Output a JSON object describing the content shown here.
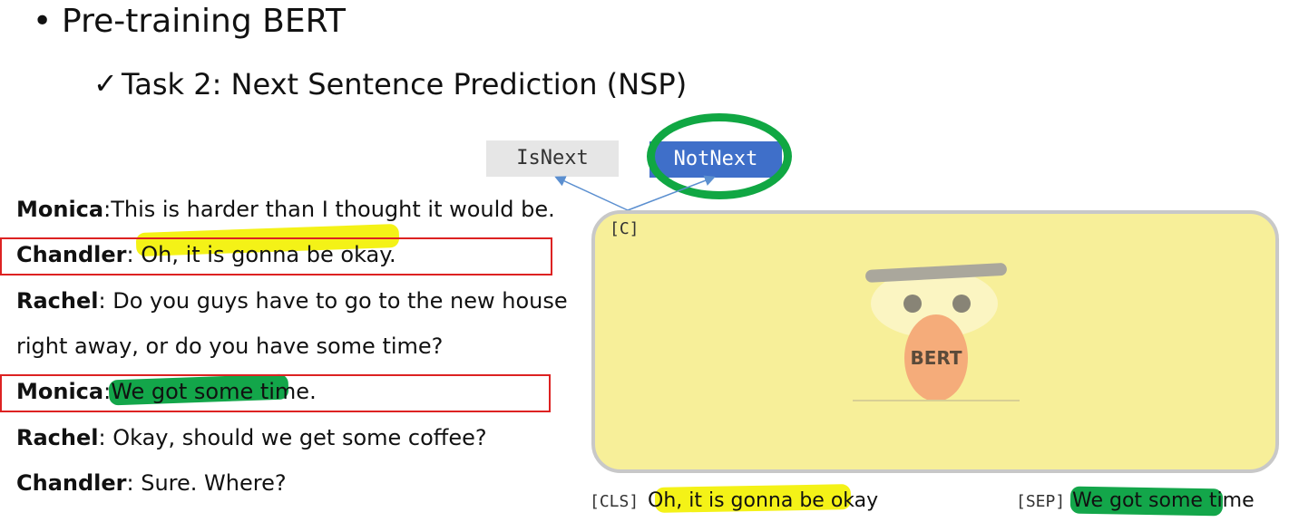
{
  "header": {
    "bullet": "•",
    "title": "Pre-training BERT",
    "check": "✓",
    "subtitle": "Task 2: Next Sentence Prediction (NSP)"
  },
  "dialogue": [
    {
      "speaker": "Monica",
      "sep": ":",
      "text": "This is harder than I thought it would be."
    },
    {
      "speaker": "Chandler",
      "sep": ": ",
      "text": "Oh, it is gonna be okay."
    },
    {
      "speaker": "Rachel",
      "sep": ": ",
      "text": "Do you guys have to go to the new house"
    },
    {
      "speaker": "",
      "sep": "",
      "text": "right away, or do you have some time?"
    },
    {
      "speaker": "Monica",
      "sep": ":",
      "text": "We got some time."
    },
    {
      "speaker": "Rachel",
      "sep": ": ",
      "text": "Okay, should we get some coffee?"
    },
    {
      "speaker": "Chandler",
      "sep": ": ",
      "text": "Sure. Where?"
    }
  ],
  "labels": {
    "is_next": "IsNext",
    "not_next": "NotNext"
  },
  "model": {
    "c_token": "[C]",
    "name": "BERT"
  },
  "input": {
    "cls_token": "[CLS]",
    "sentence_a": "Oh, it is gonna be okay",
    "sep_token": "[SEP]",
    "sentence_b": "We got some time"
  },
  "colors": {
    "highlight_yellow": "#f4f217",
    "highlight_green": "#13a64a",
    "selected_label": "#3f6fc9",
    "frame_red": "#d22222",
    "bert_body": "#f7ef99"
  }
}
